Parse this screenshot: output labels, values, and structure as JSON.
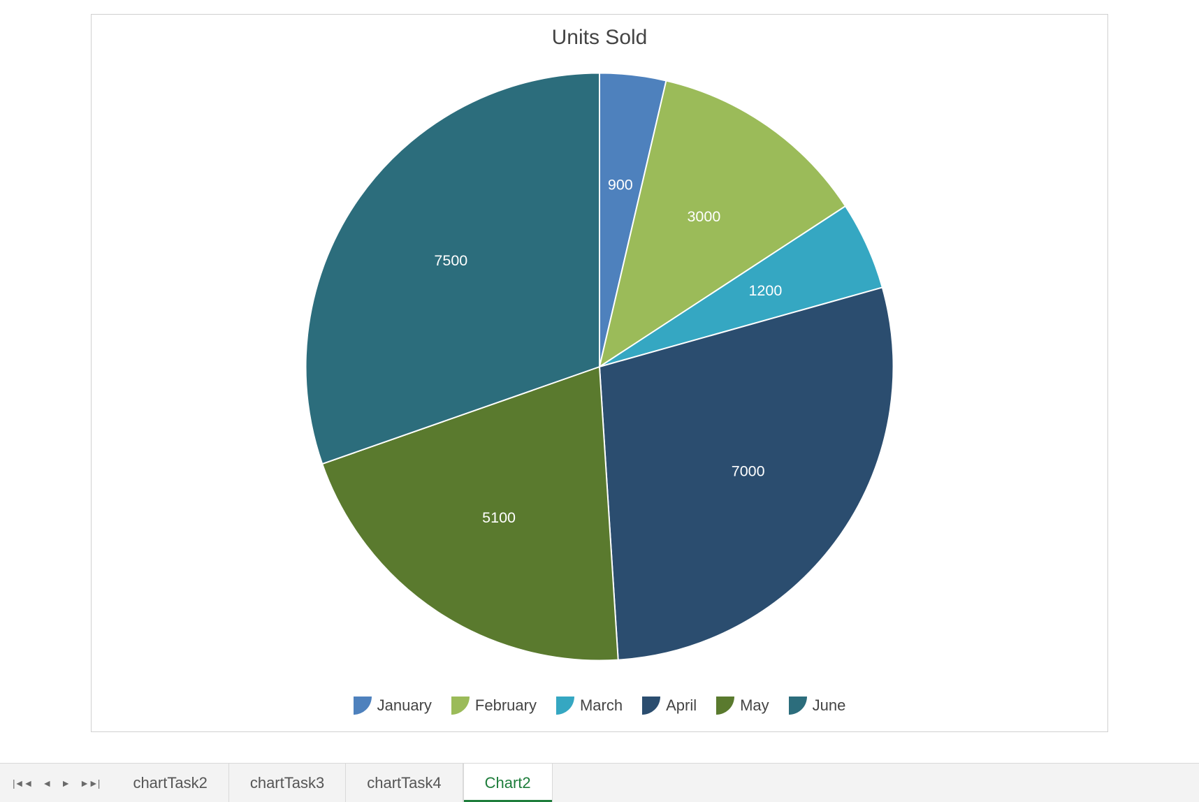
{
  "chart_data": {
    "type": "pie",
    "title": "Units Sold",
    "series": [
      {
        "name": "January",
        "value": 900,
        "color": "#4e81bd"
      },
      {
        "name": "February",
        "value": 3000,
        "color": "#9bbb59"
      },
      {
        "name": "March",
        "value": 1200,
        "color": "#35a7c2"
      },
      {
        "name": "April",
        "value": 7000,
        "color": "#2b4d6f"
      },
      {
        "name": "May",
        "value": 5100,
        "color": "#5a7a2e"
      },
      {
        "name": "June",
        "value": 7500,
        "color": "#2c6d7c"
      }
    ],
    "legend_position": "bottom",
    "data_labels": true,
    "stroke": "#ffffff"
  },
  "tabs": {
    "items": [
      "chartTask2",
      "chartTask3",
      "chartTask4",
      "Chart2"
    ],
    "active": "Chart2"
  },
  "nav_icons": {
    "first": "first-icon",
    "prev": "prev-icon",
    "next": "next-icon",
    "last": "last-icon"
  }
}
